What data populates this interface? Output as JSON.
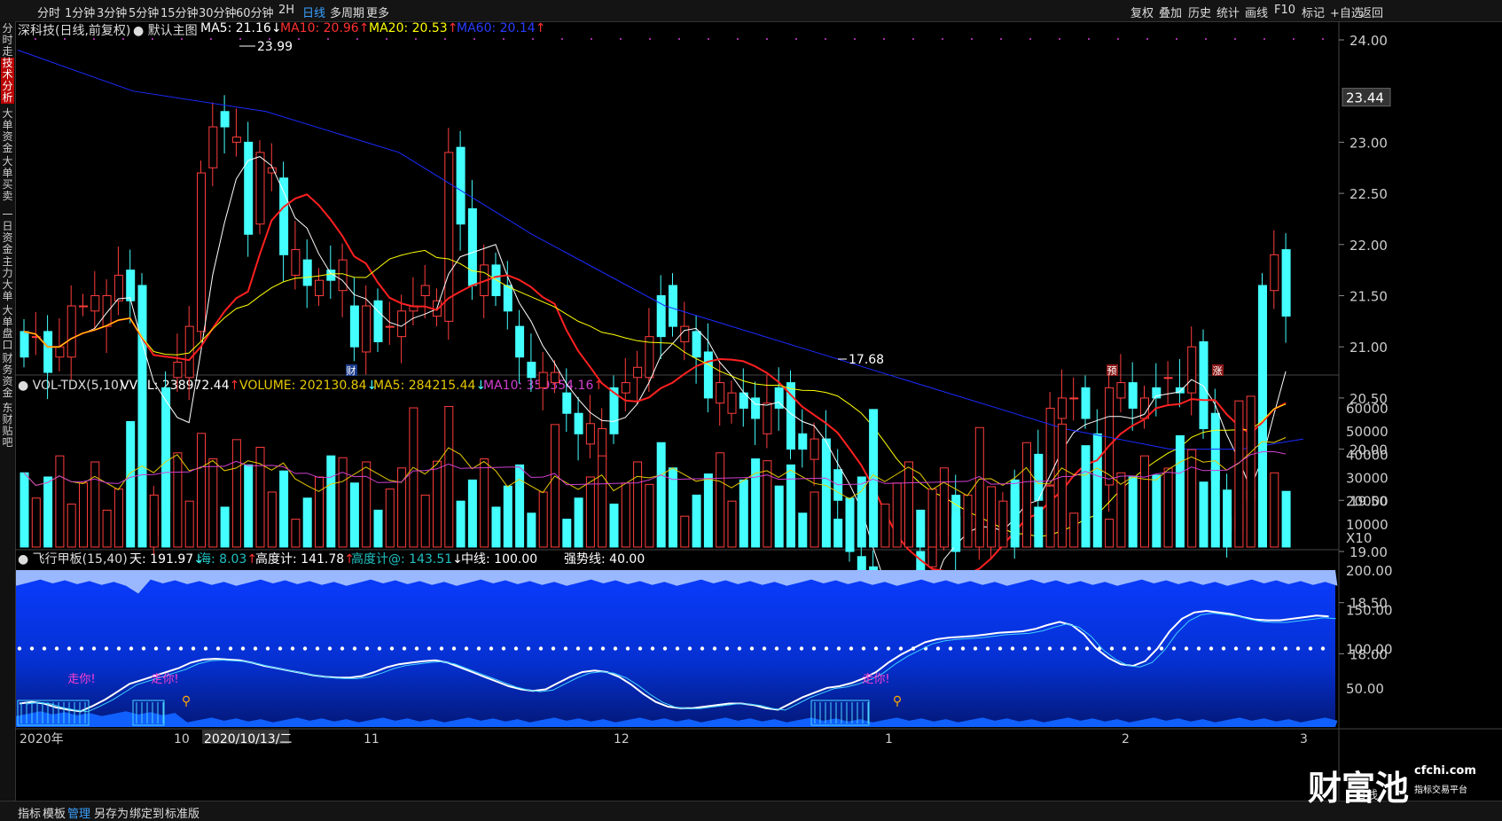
{
  "toolbar": {
    "left_items": [
      "分时",
      "1分钟",
      "3分钟",
      "5分钟",
      "15分钟",
      "30分钟",
      "60分钟",
      "2H",
      "日线",
      "多周期",
      "更多"
    ],
    "active": "日线",
    "right_items": [
      "复权",
      "叠加",
      "历史",
      "统计",
      "画线",
      "F10",
      "标记",
      "+自选",
      "返回"
    ]
  },
  "sidebar": {
    "items": [
      "分时走势",
      "技术分析",
      "大单资金",
      "大单买卖",
      "一日资金",
      "主力大单",
      "大单盘口",
      "财务资金",
      "东财贴吧"
    ],
    "active": "技术分析"
  },
  "main_chart": {
    "title": "深科技(日线,前复权)",
    "template": "默认主图",
    "ma5": "MA5: 21.16",
    "ma10": "MA10: 20.96",
    "ma20": "MA20: 20.53",
    "ma60": "MA60: 20.14",
    "high_label": "23.99",
    "low_label": "17.68",
    "current_price": "23.44",
    "markers": [
      "财",
      "预",
      "涨"
    ],
    "y_ticks": [
      "24.00",
      "23.00",
      "22.50",
      "22.00",
      "21.50",
      "21.00",
      "20.50",
      "20.00",
      "19.50",
      "19.00",
      "18.50",
      "18.00"
    ]
  },
  "volume_chart": {
    "title": "VOL-TDX(5,10)",
    "vvol": "VVOL: 238972.44",
    "volume": "VOLUME: 202130.84",
    "ma5": "MA5: 284215.44",
    "ma10": "MA10: 359354.16",
    "y_ticks": [
      "60000",
      "50000",
      "40000",
      "30000",
      "20000",
      "10000"
    ],
    "unit": "X10"
  },
  "indicator_chart": {
    "title": "飞行甲板(15,40)",
    "tian": "天: 191.97",
    "hai": "海: 8.03",
    "gaodu": "高度计: 141.78",
    "gaodu2": "高度计@: 143.51",
    "zhongxian": "中线: 100.00",
    "qiangshi": "强势线: 40.00",
    "y_ticks": [
      "200.00",
      "150.00",
      "100.00",
      "50.00"
    ],
    "signal_text": "走你!"
  },
  "x_axis": {
    "labels": [
      "2020年",
      "10",
      "2020/10/13/二",
      "11",
      "12",
      "1",
      "2",
      "3"
    ]
  },
  "bottombar": {
    "items": [
      "指标",
      "模板",
      "管理",
      "另存为",
      "绑定到",
      "标准版"
    ],
    "active": "管理",
    "period": "日线"
  },
  "watermark": {
    "logo": "财富池",
    "url": "cfchi.com",
    "tagline": "指标交易平台"
  },
  "colors": {
    "up": "#ff3d3d",
    "down": "#44ffff",
    "ma5": "#ffffff",
    "ma10": "#ff2020",
    "ma20": "#ffff00",
    "ma60": "#1a2bff",
    "vol_ma5": "#e6c800",
    "vol_ma10": "#d040d0"
  }
}
